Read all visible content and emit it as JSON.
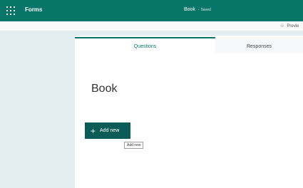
{
  "header": {
    "app_name": "Forms",
    "doc_title": "Book",
    "save_status": "Saved",
    "separator": "-"
  },
  "toolbar": {
    "preview_label": "Previe",
    "preview_icon": "eye-icon"
  },
  "tabs": [
    {
      "label": "Questions",
      "active": true
    },
    {
      "label": "Responses",
      "active": false
    }
  ],
  "form": {
    "title": "Book"
  },
  "add_new": {
    "label": "Add new",
    "icon": "+",
    "tooltip": "Add new"
  },
  "colors": {
    "brand": "#077568",
    "button": "#0b5c56",
    "canvas": "#e4eef1"
  }
}
